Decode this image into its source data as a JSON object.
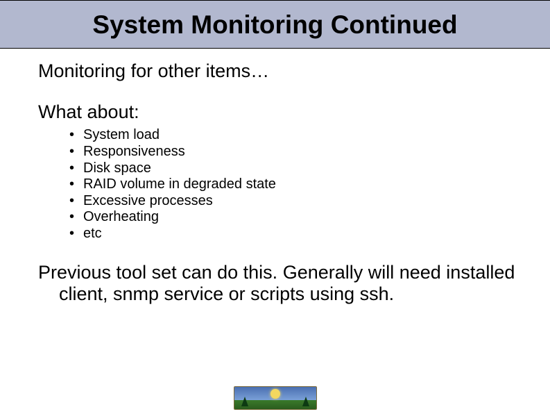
{
  "title": "System Monitoring Continued",
  "intro": "Monitoring for other items…",
  "subhead": "What about:",
  "bullets": [
    "System load",
    "Responsiveness",
    "Disk space",
    "RAID volume in degraded state",
    "Excessive processes",
    "Overheating",
    "etc"
  ],
  "closing": "Previous tool set can do this. Generally will need installed client, snmp service or scripts using ssh.",
  "footer_logo_label": "footer-logo"
}
